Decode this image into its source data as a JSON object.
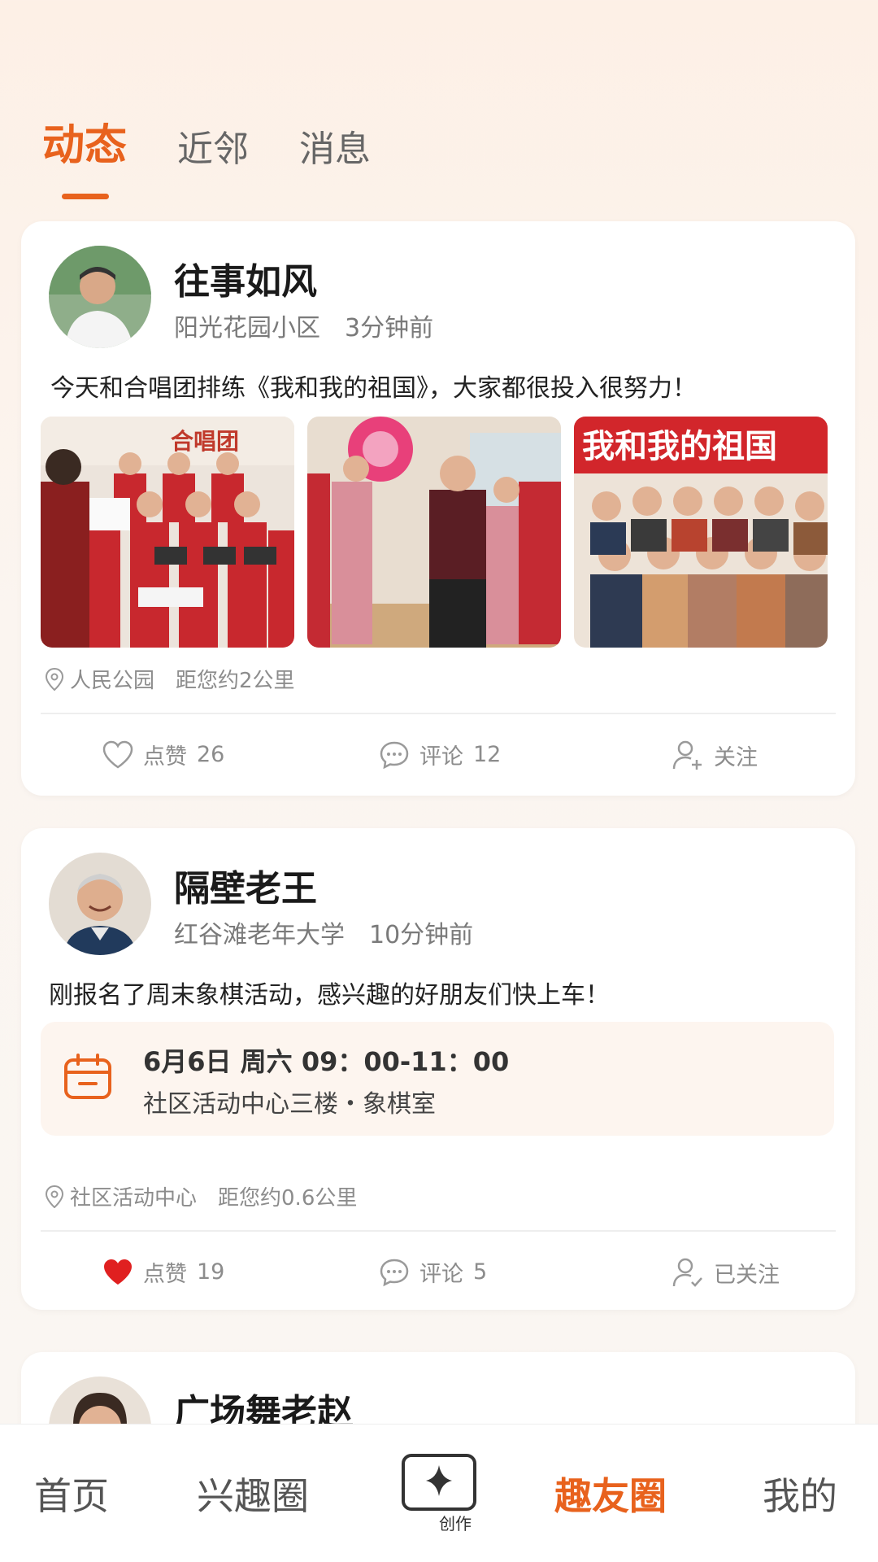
{
  "tabs": [
    {
      "label": "动态",
      "active": true
    },
    {
      "label": "近邻",
      "active": false
    },
    {
      "label": "消息",
      "active": false
    }
  ],
  "posts": [
    {
      "username": "往事如风",
      "community": "阳光花园小区",
      "time": "3分钟前",
      "text": "今天和合唱团排练《我和我的祖国》，大家都很投入很努力！",
      "photo_captions": [
        "合唱团",
        "",
        "我和我的祖国"
      ],
      "location": "人民公园",
      "distance": "距您约2公里",
      "like_label": "点赞",
      "likes": "26",
      "liked": false,
      "comment_label": "评论",
      "comments": "12",
      "follow_label": "关注"
    },
    {
      "username": "隔壁老王",
      "community": "红谷滩老年大学",
      "time": "10分钟前",
      "text": "刚报名了周末象棋活动，感兴趣的好朋友们快上车！",
      "event_time": "6月6日  周六  09：00-11：00",
      "event_place": "社区活动中心三楼・象棋室",
      "location": "社区活动中心",
      "distance": "距您约0.6公里",
      "like_label": "点赞",
      "likes": "19",
      "liked": true,
      "comment_label": "评论",
      "comments": "5",
      "follow_label": "已关注"
    },
    {
      "username": "广场舞老赵"
    }
  ],
  "nav": {
    "home": "首页",
    "interest": "兴趣圈",
    "create": "创作",
    "circle": "趣友圈",
    "mine": "我的"
  },
  "colors": {
    "accent": "#e8621d",
    "like_active": "#e02020"
  }
}
